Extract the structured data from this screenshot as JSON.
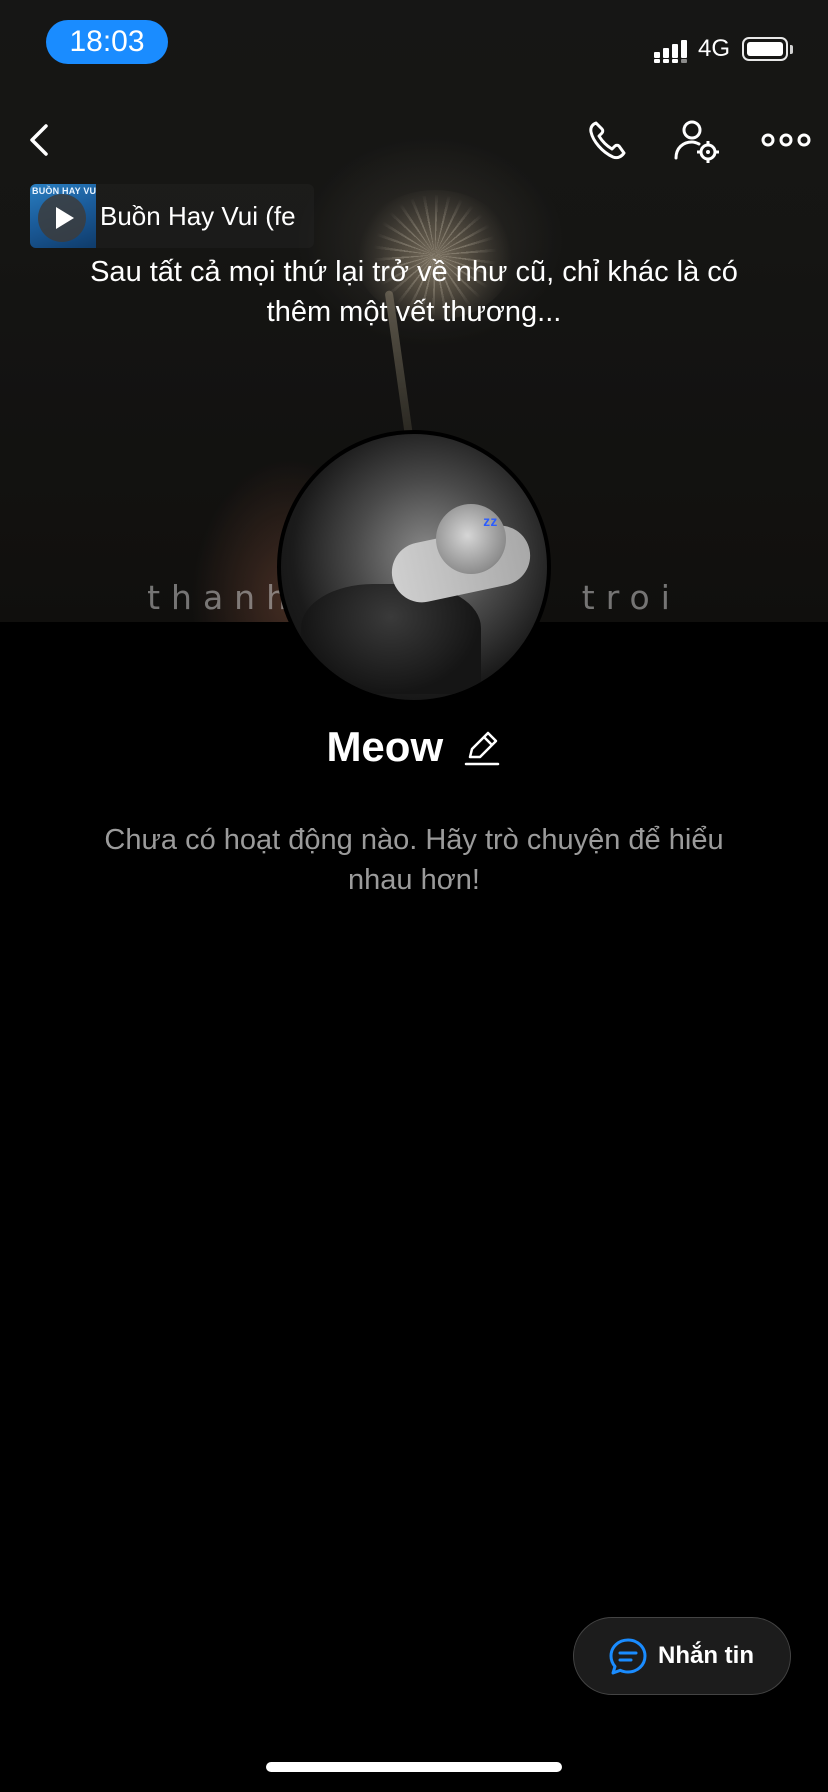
{
  "status_bar": {
    "time": "18:03",
    "network": "4G"
  },
  "nav": {
    "back_icon": "chevron-left-icon",
    "call_icon": "phone-icon",
    "settings_icon": "user-settings-icon",
    "more_icon": "more-horizontal-icon"
  },
  "music": {
    "album_art_text": "BUỒN HAY VUI",
    "title": "Buồn Hay Vui (fe"
  },
  "profile": {
    "status_text": "Sau tất cả mọi thứ lại trở về như cũ, chỉ khác là có thêm một vết thương...",
    "cover_caption": "thanh xuân bay troi",
    "name": "Meow",
    "edit_icon": "edit-pencil-icon"
  },
  "activity": {
    "empty_text": "Chưa có hoạt động nào. Hãy trò chuyện để hiểu nhau hơn!"
  },
  "actions": {
    "message_label": "Nhắn tin",
    "message_icon": "chat-bubble-icon"
  },
  "colors": {
    "accent": "#1a8cff",
    "background": "#000000",
    "muted_text": "#9b9b9b"
  }
}
